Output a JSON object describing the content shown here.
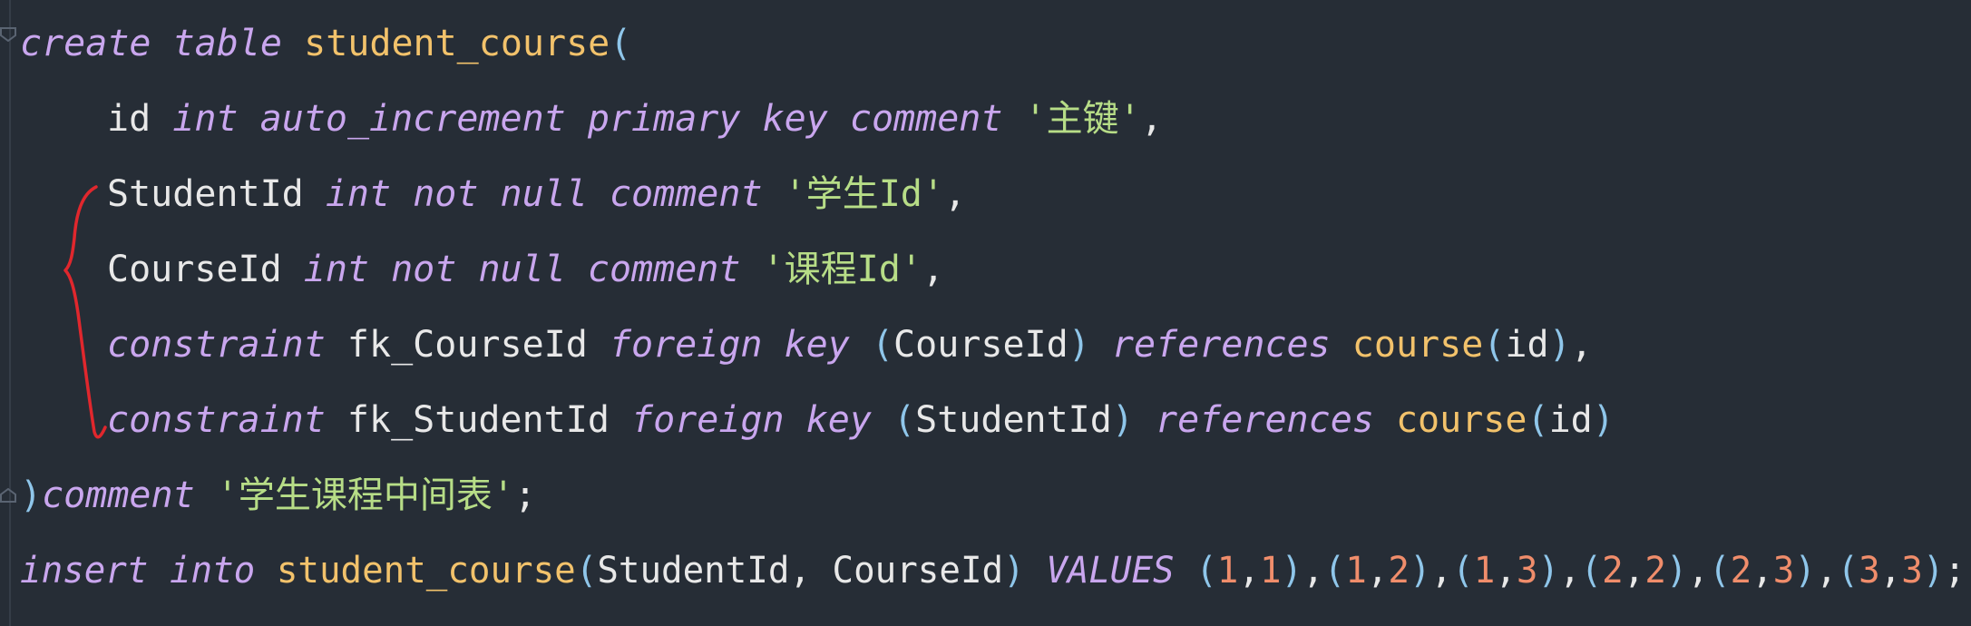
{
  "code": {
    "line1": {
      "create": "create",
      "table": "table",
      "name": "student_course",
      "paren": "("
    },
    "line2": {
      "col": "id",
      "int": "int",
      "auto": "auto_increment",
      "primary": "primary",
      "key": "key",
      "comment": "comment",
      "str": "'主键'",
      "end": ","
    },
    "line3": {
      "col": "StudentId",
      "int": "int",
      "not": "not",
      "null": "null",
      "comment": "comment",
      "str": "'学生Id'",
      "end": ","
    },
    "line4": {
      "col": "CourseId",
      "int": "int",
      "not": "not",
      "null": "null",
      "comment": "comment",
      "str": "'课程Id'",
      "end": ","
    },
    "line5": {
      "constraint": "constraint",
      "fk": "fk_CourseId",
      "foreign": "foreign",
      "key": "key",
      "open": "(",
      "col": "CourseId",
      "close": ")",
      "references": "references",
      "table": "course",
      "ropen": "(",
      "rcol": "id",
      "rclose": ")",
      "end": ","
    },
    "line6": {
      "constraint": "constraint",
      "fk": "fk_StudentId",
      "foreign": "foreign",
      "key": "key",
      "open": "(",
      "col": "StudentId",
      "close": ")",
      "references": "references",
      "table": "course",
      "ropen": "(",
      "rcol": "id",
      "rclose": ")"
    },
    "line7": {
      "close": ")",
      "comment": "comment",
      "str": "'学生课程中间表'",
      "end": ";"
    },
    "line8": {
      "insert": "insert",
      "into": "into",
      "table": "student_course",
      "open": "(",
      "cols": "StudentId, CourseId",
      "close": ")",
      "values": "VALUES",
      "tuples": [
        [
          "1",
          "1"
        ],
        [
          "1",
          "2"
        ],
        [
          "1",
          "3"
        ],
        [
          "2",
          "2"
        ],
        [
          "2",
          "3"
        ],
        [
          "3",
          "3"
        ]
      ],
      "end": ";"
    }
  },
  "colors": {
    "background": "#262d36",
    "keyword": "#c9a6ee",
    "function": "#f2c26b",
    "string": "#b7dd87",
    "number": "#f08d6b",
    "paren": "#8fc6ea",
    "annotation": "#e0272d"
  }
}
